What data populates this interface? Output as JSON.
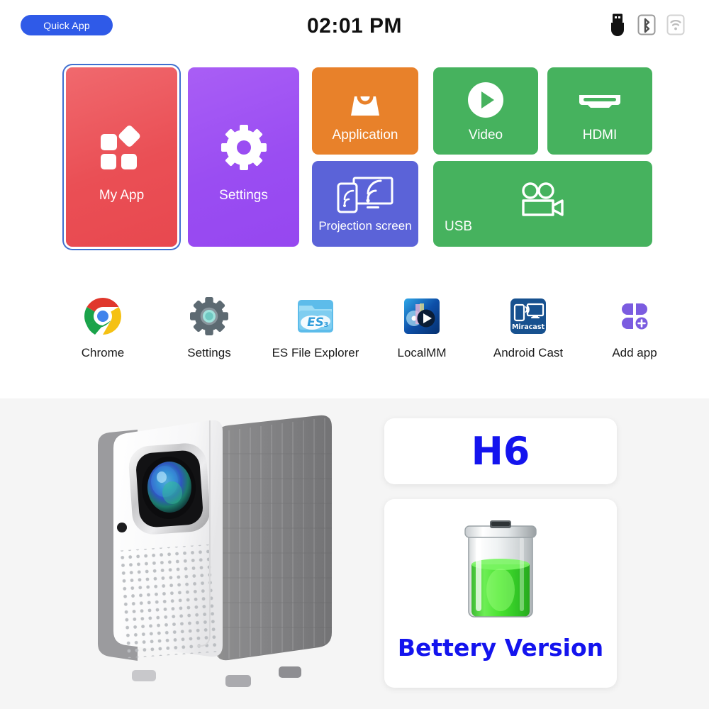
{
  "statusbar": {
    "quick_app_label": "Quick App",
    "time": "02:01 PM",
    "icons": [
      {
        "name": "usb-icon",
        "label": "USB"
      },
      {
        "name": "bluetooth-icon",
        "label": "Bluetooth"
      },
      {
        "name": "wifi-icon",
        "label": "Wi-Fi"
      }
    ],
    "accent_color": "#2f5ae8"
  },
  "tiles": [
    {
      "id": "my-app",
      "label": "My App",
      "icon": "app-grid-icon",
      "color": "#ea4f55",
      "focused": true
    },
    {
      "id": "settings",
      "label": "Settings",
      "icon": "gear-icon",
      "color": "#9a4df2",
      "focused": false
    },
    {
      "id": "application",
      "label": "Application",
      "icon": "shopping-bag-icon",
      "color": "#e8812a",
      "focused": false
    },
    {
      "id": "projection-screen",
      "label": "Projection screen",
      "icon": "screen-mirroring-icon",
      "color": "#5b63d8",
      "focused": false
    },
    {
      "id": "video",
      "label": "Video",
      "icon": "play-circle-icon",
      "color": "#46b25e",
      "focused": false
    },
    {
      "id": "hdmi",
      "label": "HDMI",
      "icon": "hdmi-port-icon",
      "color": "#46b25e",
      "focused": false
    },
    {
      "id": "usb",
      "label": "USB",
      "icon": "video-camera-icon",
      "color": "#46b25e",
      "focused": false
    }
  ],
  "dock": [
    {
      "id": "chrome",
      "label": "Chrome",
      "icon": "chrome-icon"
    },
    {
      "id": "settings",
      "label": "Settings",
      "icon": "gear-icon"
    },
    {
      "id": "es-file-explorer",
      "label": "ES File Explorer",
      "icon": "es-file-explorer-icon"
    },
    {
      "id": "localmm",
      "label": "LocalMM",
      "icon": "localmm-icon"
    },
    {
      "id": "android-cast",
      "label": "Android Cast",
      "icon": "miracast-icon",
      "icon_text": "Miracast"
    },
    {
      "id": "add-app",
      "label": "Add app",
      "icon": "add-app-icon"
    }
  ],
  "product": {
    "device_image": "projector-photo",
    "model": "H6",
    "battery_icon": "battery-full-icon",
    "battery_label": "Bettery Version",
    "text_color": "#1414ee",
    "background": "#f5f5f5"
  }
}
